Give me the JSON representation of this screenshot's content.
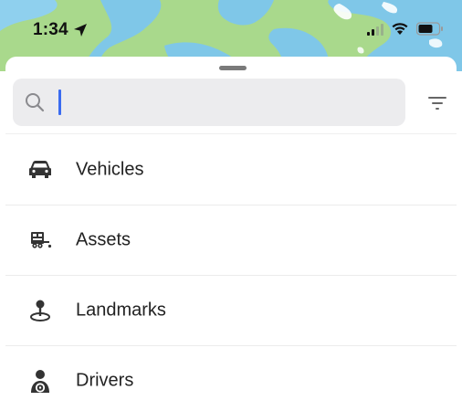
{
  "status_bar": {
    "time": "1:34"
  },
  "search": {
    "placeholder": "",
    "value": ""
  },
  "list": {
    "items": [
      {
        "label": "Vehicles",
        "icon": "car-icon"
      },
      {
        "label": "Assets",
        "icon": "trailer-icon"
      },
      {
        "label": "Landmarks",
        "icon": "landmark-pin-icon"
      },
      {
        "label": "Drivers",
        "icon": "driver-icon"
      }
    ]
  },
  "colors": {
    "map_land": "#a9d98c",
    "map_water": "#7fc7e8",
    "search_bg": "#ececee",
    "caret": "#3b6cf0",
    "text": "#222222"
  }
}
